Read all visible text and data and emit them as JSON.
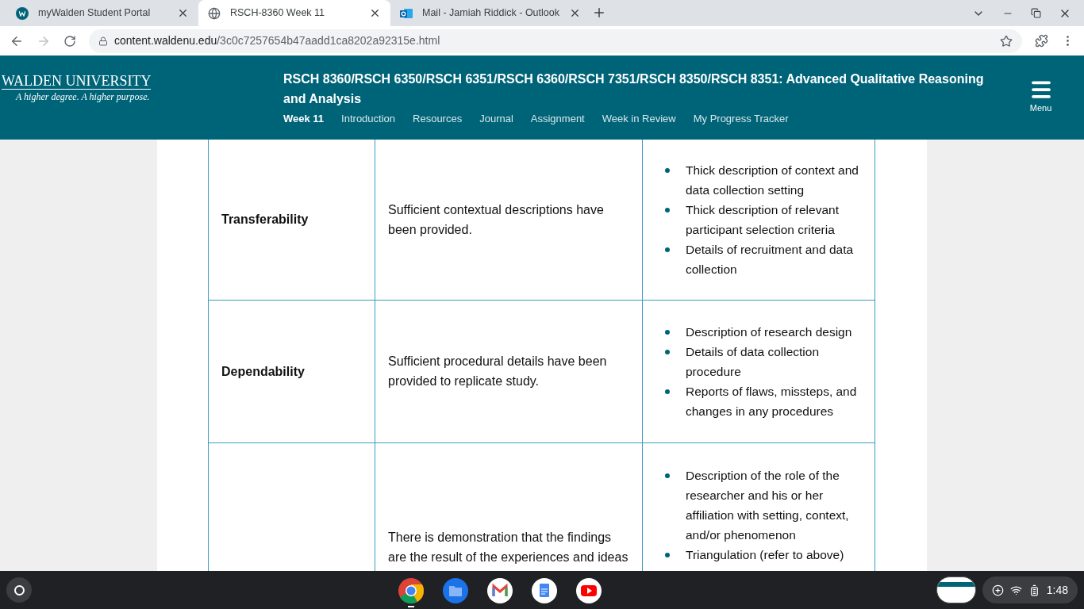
{
  "browser": {
    "tabs": [
      {
        "title": "myWalden Student Portal",
        "selected": false
      },
      {
        "title": "RSCH-8360 Week 11",
        "selected": true
      },
      {
        "title": "Mail - Jamiah Riddick - Outlook",
        "selected": false
      }
    ],
    "url_host": "content.waldenu.edu",
    "url_path": "/3c0c7257654b47aadd1ca8202a92315e.html"
  },
  "header": {
    "logo_name": "WALDEN UNIVERSITY",
    "logo_tagline": "A higher degree. A higher purpose.",
    "course_title": "RSCH 8360/RSCH 6350/RSCH 6351/RSCH 6360/RSCH 7351/RSCH 8350/RSCH 8351: Advanced Qualitative Reasoning and Analysis",
    "nav": [
      {
        "label": "Week 11",
        "selected": true
      },
      {
        "label": "Introduction",
        "selected": false
      },
      {
        "label": "Resources",
        "selected": false
      },
      {
        "label": "Journal",
        "selected": false
      },
      {
        "label": "Assignment",
        "selected": false
      },
      {
        "label": "Week in Review",
        "selected": false
      },
      {
        "label": "My Progress Tracker",
        "selected": false
      }
    ],
    "menu_label": "Menu"
  },
  "table": {
    "rows": [
      {
        "criterion": "Transferability",
        "description": "Sufficient contextual descriptions have been provided.",
        "evidence": [
          "Thick description of context and data collection setting",
          "Thick description of relevant participant selection criteria",
          "Details of recruitment and data collection"
        ]
      },
      {
        "criterion": "Dependability",
        "description": "Sufficient procedural details have been provided to replicate study.",
        "evidence": [
          "Description of research design",
          "Details of data collection procedure",
          "Reports of flaws, missteps, and changes in any procedures"
        ]
      },
      {
        "description": "There is demonstration that the findings are the result of the experiences and ideas",
        "evidence": [
          "Description of the role of the researcher and his or her affiliation with setting, context, and/or phenomenon",
          "Triangulation (refer to above)"
        ]
      }
    ]
  },
  "taskbar": {
    "time": "1:48"
  }
}
